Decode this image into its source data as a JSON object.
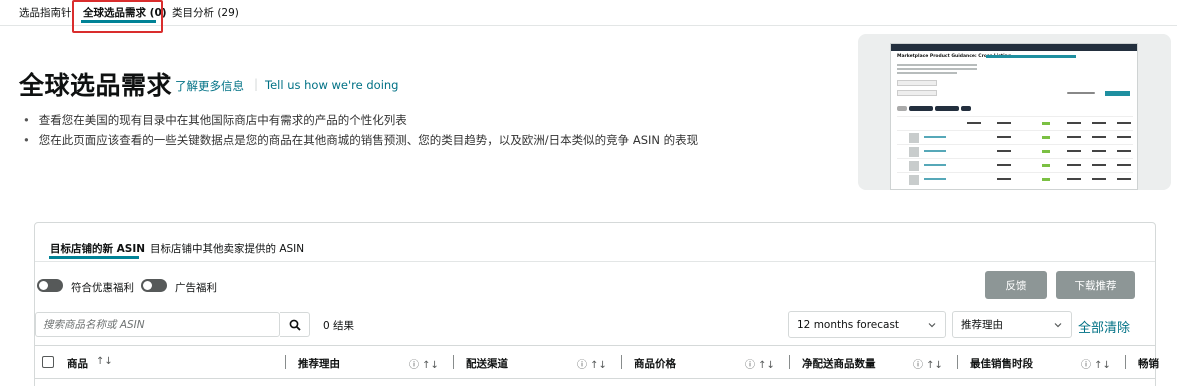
{
  "top_tabs": [
    {
      "label": "选品指南针"
    },
    {
      "label": "全球选品需求 (0)"
    },
    {
      "label": "类目分析 (29)"
    }
  ],
  "header": {
    "title": "全球选品需求",
    "learn_more": "了解更多信息",
    "separator": "|",
    "feedback_link": "Tell us how we're doing"
  },
  "bullets": [
    "查看您在美国的现有目录中在其他国际商店中有需求的产品的个性化列表",
    "您在此页面应该查看的一些关键数据点是您的商品在其他商城的销售预测、您的类目趋势，以及欧洲/日本类似的竞争 ASIN 的表现"
  ],
  "preview": {
    "title": "Marketplace Product Guidance: Cross Listing"
  },
  "subtabs": [
    {
      "label": "目标店铺的新 ASIN"
    },
    {
      "label": "目标店铺中其他卖家提供的 ASIN"
    }
  ],
  "toggles": [
    {
      "label": "符合优惠福利"
    },
    {
      "label": "广告福利"
    }
  ],
  "buttons": {
    "feedback": "反馈",
    "download": "下载推荐"
  },
  "search": {
    "placeholder": "搜索商品名称或 ASIN",
    "result_count": "0 结果"
  },
  "filters": {
    "forecast": "12 months forecast",
    "reason": "推荐理由",
    "clear_all": "全部清除"
  },
  "columns": [
    {
      "label": "商品",
      "icons": "↑↓"
    },
    {
      "label": "推荐理由",
      "icons": "ⓘ ↑↓"
    },
    {
      "label": "配送渠道",
      "icons": "ⓘ ↑↓"
    },
    {
      "label": "商品价格",
      "icons": "ⓘ ↑↓"
    },
    {
      "label": "净配送商品数量",
      "icons": "ⓘ ↑↓"
    },
    {
      "label": "最佳销售时段",
      "icons": "ⓘ ↑↓"
    },
    {
      "label": "畅销"
    }
  ],
  "colors": {
    "accent": "#008296",
    "link": "#007185",
    "highlight": "#d92d2d",
    "button_gray": "#8d9696"
  }
}
